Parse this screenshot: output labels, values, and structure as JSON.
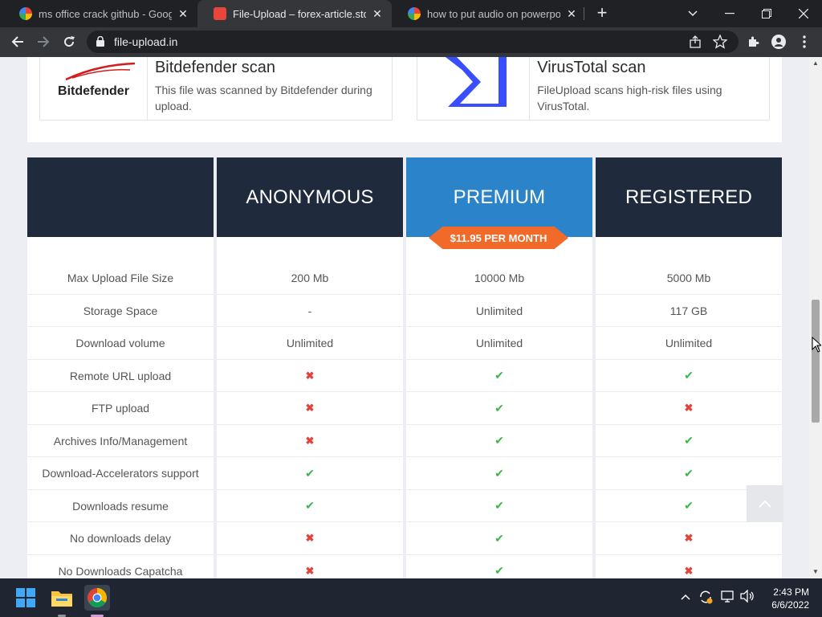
{
  "browser": {
    "tabs": [
      {
        "title": "ms office crack github - Google S",
        "favicon": "google-icon",
        "active": false
      },
      {
        "title": "File-Upload – forex-article.store -",
        "favicon": "fileupload-icon",
        "active": true
      },
      {
        "title": "how to put audio on powerpoint",
        "favicon": "google-icon",
        "active": false
      }
    ],
    "url": "file-upload.in",
    "new_tab_symbol": "+"
  },
  "scans": [
    {
      "logo_text": "Bitdefender",
      "title": "Bitdefender scan",
      "description": "This file was scanned by Bitdefender during upload."
    },
    {
      "logo_text": "",
      "title": "VirusTotal scan",
      "description": "FileUpload scans high-risk files using VirusTotal."
    }
  ],
  "plans": {
    "columns": [
      "",
      "ANONYMOUS",
      "PREMIUM",
      "REGISTERED"
    ],
    "premium_price": "$11.95 PER MONTH",
    "header_colors": {
      "dark": "#1f2b3d",
      "premium": "#2b84c9"
    },
    "rows": [
      {
        "feature": "Max Upload File Size",
        "anonymous": "200 Mb",
        "premium": "10000 Mb",
        "registered": "5000 Mb"
      },
      {
        "feature": "Storage Space",
        "anonymous": "-",
        "premium": "Unlimited",
        "registered": "117 GB"
      },
      {
        "feature": "Download volume",
        "anonymous": "Unlimited",
        "premium": "Unlimited",
        "registered": "Unlimited"
      },
      {
        "feature": "Remote URL upload",
        "anonymous": "cross",
        "premium": "check",
        "registered": "check"
      },
      {
        "feature": "FTP upload",
        "anonymous": "cross",
        "premium": "check",
        "registered": "cross"
      },
      {
        "feature": "Archives Info/Management",
        "anonymous": "cross",
        "premium": "check",
        "registered": "check"
      },
      {
        "feature": "Download-Accelerators support",
        "anonymous": "check",
        "premium": "check",
        "registered": "check"
      },
      {
        "feature": "Downloads resume",
        "anonymous": "check",
        "premium": "check",
        "registered": "check"
      },
      {
        "feature": "No downloads delay",
        "anonymous": "cross",
        "premium": "check",
        "registered": "cross"
      },
      {
        "feature": "No Downloads Capatcha",
        "anonymous": "cross",
        "premium": "check",
        "registered": "cross"
      }
    ]
  },
  "taskbar": {
    "time": "2:43 PM",
    "date": "6/6/2022"
  }
}
